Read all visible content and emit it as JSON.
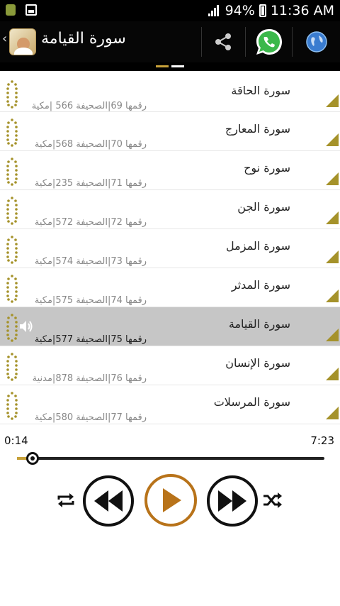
{
  "status_bar": {
    "battery": "94%",
    "time": "11:36 AM"
  },
  "action_bar": {
    "title": "سورة القيامة",
    "icons": [
      "back-chevron-icon",
      "app-logo",
      "share-icon",
      "whatsapp-icon",
      "globe-icon"
    ]
  },
  "colors": {
    "accent_gold": "#a5922a",
    "play_ring": "#b8731a",
    "active_row": "#c6c6c6",
    "seek_progress": "#c7a13a"
  },
  "pager": {
    "pages": 2,
    "active_index": 0
  },
  "surahs": [
    {
      "title": "سورة الحاقة",
      "meta": "رقمها 69|الصحيفة 566 |مكية",
      "active": false
    },
    {
      "title": "سورة المعارج",
      "meta": "رقمها 70|الصحيفة 568|مكية",
      "active": false
    },
    {
      "title": "سورة نوح",
      "meta": "رقمها 71|الصحيفة 235|مكية",
      "active": false
    },
    {
      "title": "سورة الجن",
      "meta": "رقمها 72|الصحيفة 572|مكية",
      "active": false
    },
    {
      "title": "سورة المزمل",
      "meta": "رقمها 73|الصحيفة 574|مكية",
      "active": false
    },
    {
      "title": "سورة المدثر",
      "meta": "رقمها 74|الصحيفة 575|مكية",
      "active": false
    },
    {
      "title": "سورة القيامة",
      "meta": "رقمها 75|الصحيفة 577|مكية",
      "active": true
    },
    {
      "title": "سورة الإنسان",
      "meta": "رقمها 76|الصحيفة 878|مدنية",
      "active": false
    },
    {
      "title": "سورة المرسلات",
      "meta": "رقمها 77|الصحيفة 580|مكية",
      "active": false
    }
  ],
  "player": {
    "elapsed": "0:14",
    "duration": "7:23",
    "progress_fraction": 0.05,
    "controls": [
      "repeat-icon",
      "rewind-icon",
      "play-icon",
      "fast-forward-icon",
      "shuffle-icon"
    ]
  }
}
